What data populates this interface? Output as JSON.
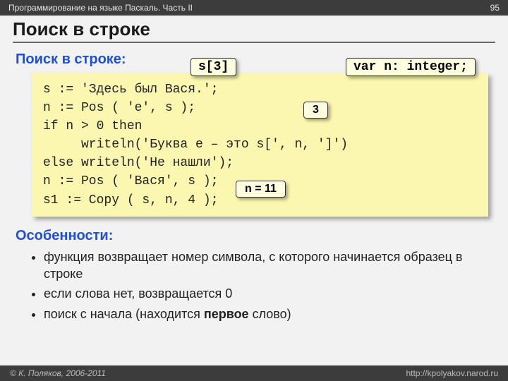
{
  "topbar": {
    "left": "Программирование на языке Паскаль. Часть II",
    "right": "95"
  },
  "title": "Поиск в строке",
  "subtitle": "Поиск в строке:",
  "callouts": {
    "s3": "s[3]",
    "varn": "var n: integer;",
    "three": "3",
    "n11": "n = 11"
  },
  "code": "s := 'Здесь был Вася.';\nn := Pos ( 'е', s );\nif n > 0 then\n     writeln('Буква е – это s[', n, ']')\nelse writeln('Не нашли');\nn := Pos ( 'Вася', s );\ns1 := Copy ( s, n, 4 );",
  "features_title": "Особенности:",
  "features": [
    {
      "pre": "функция возвращает номер символа, с которого начинается образец в строке"
    },
    {
      "pre": "если слова нет, возвращается 0"
    },
    {
      "pre": "поиск с начала (находится ",
      "bold": "первое",
      "post": " слово)"
    }
  ],
  "footer": {
    "left": "© К. Поляков, 2006-2011",
    "right": "http://kpolyakov.narod.ru"
  }
}
